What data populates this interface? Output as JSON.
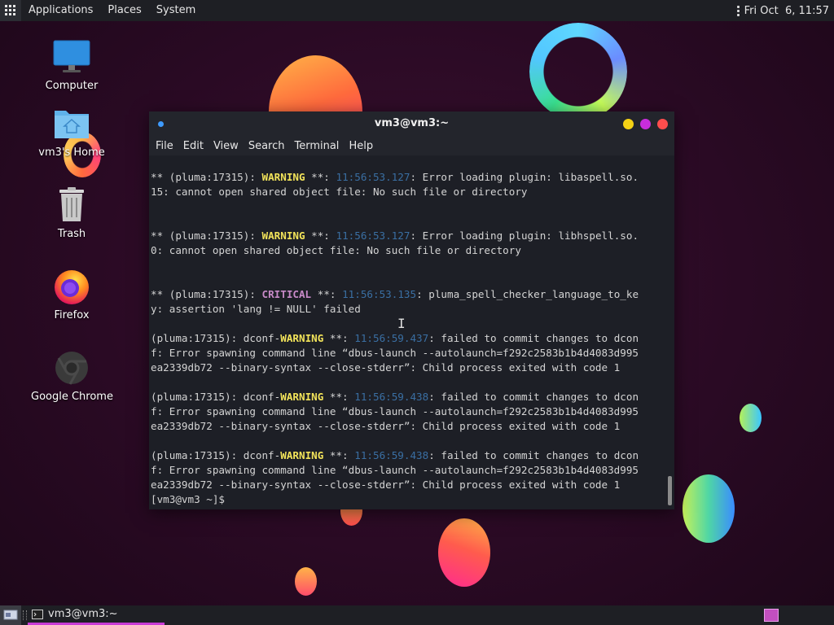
{
  "top_panel": {
    "menus": [
      "Applications",
      "Places",
      "System"
    ],
    "clock": "Fri Oct  6, 11:57"
  },
  "desktop_icons": [
    {
      "label": "Computer",
      "icon": "computer-icon"
    },
    {
      "label": "vm3's Home",
      "icon": "home-folder-icon"
    },
    {
      "label": "Trash",
      "icon": "trash-icon"
    },
    {
      "label": "Firefox",
      "icon": "firefox-icon"
    },
    {
      "label": "Google Chrome",
      "icon": "chrome-icon"
    }
  ],
  "terminal": {
    "title": "vm3@vm3:~",
    "menu": [
      "File",
      "Edit",
      "View",
      "Search",
      "Terminal",
      "Help"
    ],
    "lines": [
      [
        {
          "t": "** (pluma:17315): "
        },
        {
          "t": "WARNING",
          "s": "w"
        },
        {
          "t": " **: "
        },
        {
          "t": "11:56:53.127",
          "s": "ts"
        },
        {
          "t": ": Error loading plugin: libaspell.so."
        }
      ],
      [
        {
          "t": "15: cannot open shared object file: No such file or directory"
        }
      ],
      [
        {
          "t": ""
        }
      ],
      [
        {
          "t": ""
        }
      ],
      [
        {
          "t": "** (pluma:17315): "
        },
        {
          "t": "WARNING",
          "s": "w"
        },
        {
          "t": " **: "
        },
        {
          "t": "11:56:53.127",
          "s": "ts"
        },
        {
          "t": ": Error loading plugin: libhspell.so."
        }
      ],
      [
        {
          "t": "0: cannot open shared object file: No such file or directory"
        }
      ],
      [
        {
          "t": ""
        }
      ],
      [
        {
          "t": ""
        }
      ],
      [
        {
          "t": "** (pluma:17315): "
        },
        {
          "t": "CRITICAL",
          "s": "c"
        },
        {
          "t": " **: "
        },
        {
          "t": "11:56:53.135",
          "s": "ts"
        },
        {
          "t": ": pluma_spell_checker_language_to_ke"
        }
      ],
      [
        {
          "t": "y: assertion 'lang != NULL' failed"
        }
      ],
      [
        {
          "t": ""
        }
      ],
      [
        {
          "t": "(pluma:17315): dconf-"
        },
        {
          "t": "WARNING",
          "s": "w"
        },
        {
          "t": " **: "
        },
        {
          "t": "11:56:59.437",
          "s": "ts"
        },
        {
          "t": ": failed to commit changes to dcon"
        }
      ],
      [
        {
          "t": "f: Error spawning command line “dbus-launch --autolaunch=f292c2583b1b4d4083d995"
        }
      ],
      [
        {
          "t": "ea2339db72 --binary-syntax --close-stderr”: Child process exited with code 1"
        }
      ],
      [
        {
          "t": ""
        }
      ],
      [
        {
          "t": "(pluma:17315): dconf-"
        },
        {
          "t": "WARNING",
          "s": "w"
        },
        {
          "t": " **: "
        },
        {
          "t": "11:56:59.438",
          "s": "ts"
        },
        {
          "t": ": failed to commit changes to dcon"
        }
      ],
      [
        {
          "t": "f: Error spawning command line “dbus-launch --autolaunch=f292c2583b1b4d4083d995"
        }
      ],
      [
        {
          "t": "ea2339db72 --binary-syntax --close-stderr”: Child process exited with code 1"
        }
      ],
      [
        {
          "t": ""
        }
      ],
      [
        {
          "t": "(pluma:17315): dconf-"
        },
        {
          "t": "WARNING",
          "s": "w"
        },
        {
          "t": " **: "
        },
        {
          "t": "11:56:59.438",
          "s": "ts"
        },
        {
          "t": ": failed to commit changes to dcon"
        }
      ],
      [
        {
          "t": "f: Error spawning command line “dbus-launch --autolaunch=f292c2583b1b4d4083d995"
        }
      ],
      [
        {
          "t": "ea2339db72 --binary-syntax --close-stderr”: Child process exited with code 1"
        }
      ],
      [
        {
          "t": "[vm3@vm3 ~]$ "
        }
      ]
    ]
  },
  "taskbar": {
    "window_button": "vm3@vm3:~"
  },
  "colors": {
    "warning": "#f2e35a",
    "critical": "#c88ac8",
    "timestamp": "#3a6fa3",
    "close": "#ff4d4d",
    "maximize": "#c92ddc",
    "minimize": "#f5d215"
  }
}
